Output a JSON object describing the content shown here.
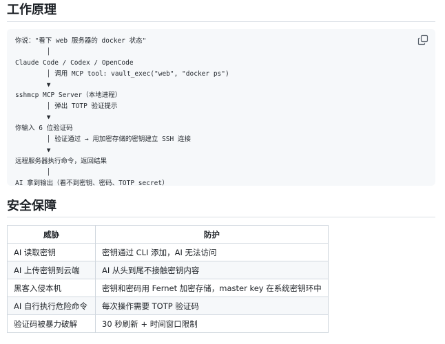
{
  "section_principle": {
    "title": "工作原理"
  },
  "code": {
    "copy_icon": "copy-icon",
    "lines": [
      "你说：\"看下 web 服务器的 docker 状态\"",
      "        │",
      "Claude Code / Codex / OpenCode",
      "        │ 调用 MCP tool: vault_exec(\"web\", \"docker ps\")",
      "        ▼",
      "sshmcp MCP Server（本地进程）",
      "        │ 弹出 TOTP 验证提示",
      "        ▼",
      "你输入 6 位验证码",
      "        │ 验证通过 → 用加密存储的密钥建立 SSH 连接",
      "        ▼",
      "远程服务器执行命令，返回结果",
      "        │",
      "AI 拿到输出（看不到密钥、密码、TOTP secret）"
    ]
  },
  "section_security": {
    "title": "安全保障"
  },
  "table": {
    "headers": [
      "威胁",
      "防护"
    ],
    "rows": [
      [
        "AI 读取密钥",
        "密钥通过 CLI 添加，AI 无法访问"
      ],
      [
        "AI 上传密钥到云端",
        "AI 从头到尾不接触密钥内容"
      ],
      [
        "黑客入侵本机",
        "密钥和密码用 Fernet 加密存储，master key 在系统密钥环中"
      ],
      [
        "AI 自行执行危险命令",
        "每次操作需要 TOTP 验证码"
      ],
      [
        "验证码被暴力破解",
        "30 秒刷新 + 时间窗口限制"
      ]
    ]
  }
}
